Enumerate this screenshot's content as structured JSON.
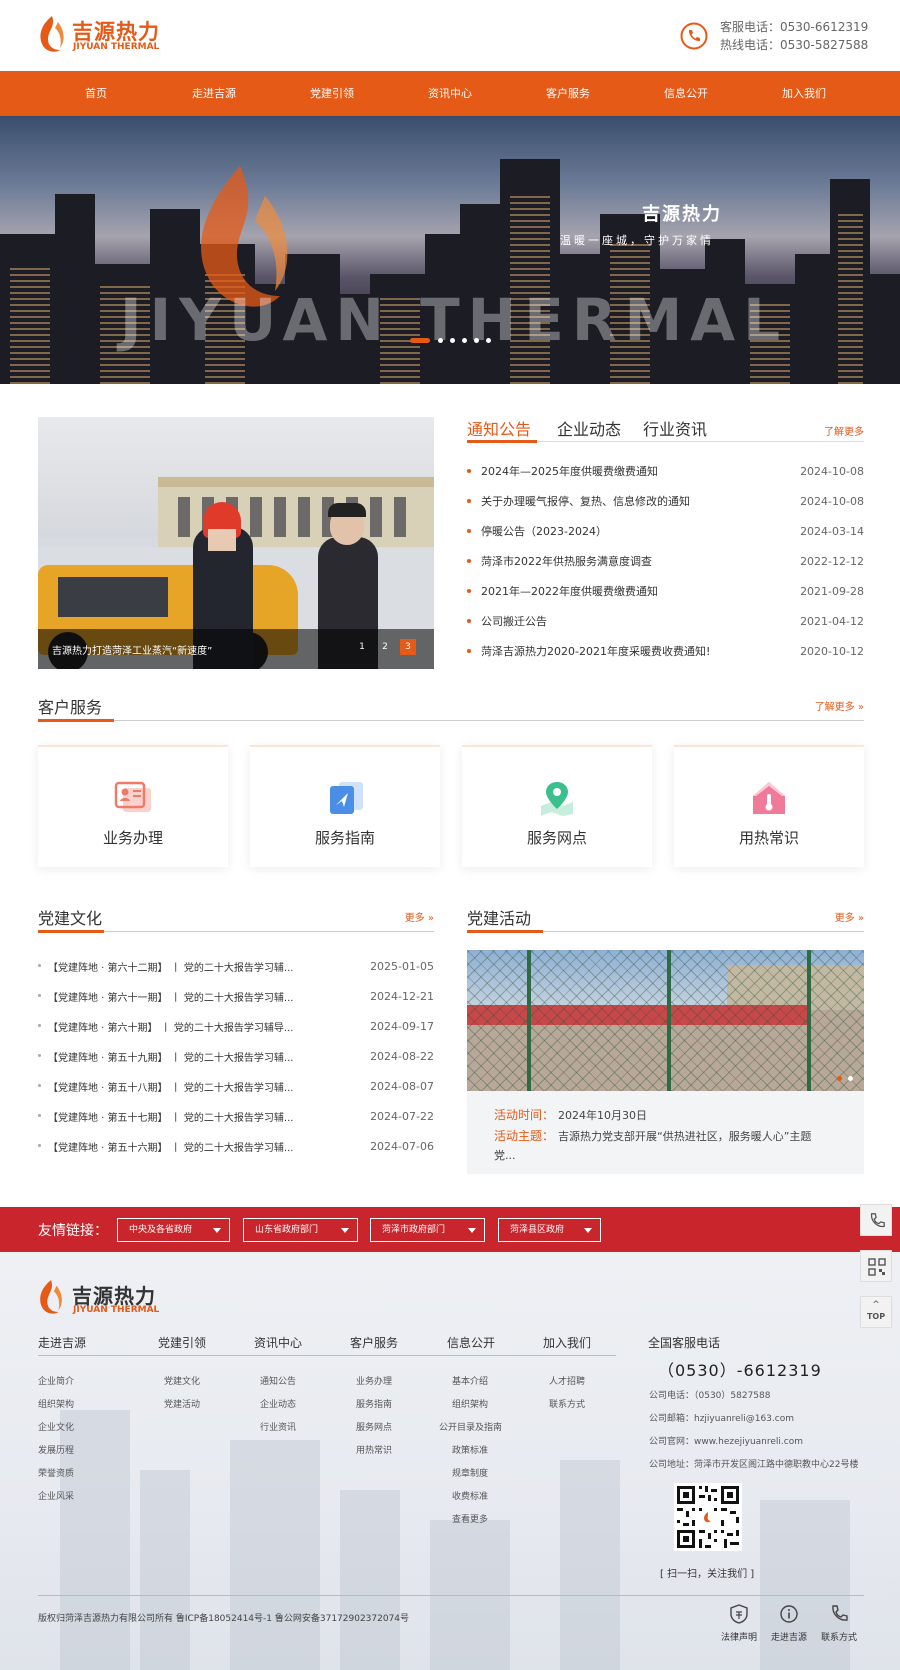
{
  "header": {
    "logo_cn": "吉源热力",
    "logo_en": "JIYUAN THERMAL",
    "hotline1": "客服电话：0530-6612319",
    "hotline2": "热线电话：0530-5827588"
  },
  "nav": [
    "首页",
    "走进吉源",
    "党建引领",
    "资讯中心",
    "客户服务",
    "信息公开",
    "加入我们"
  ],
  "banner": {
    "title": "吉源热力",
    "slogan": "温暖一座城，守护万家情",
    "watermark": "JIYUAN THERMAL"
  },
  "news": {
    "caption": "吉源热力打造菏泽工业蒸汽“新速度”",
    "pages": [
      "1",
      "2",
      "3"
    ],
    "tabs": [
      "通知公告",
      "企业动态",
      "行业资讯"
    ],
    "more": "了解更多",
    "items": [
      {
        "title": "2024年—2025年度供暖费缴费通知",
        "date": "2024-10-08"
      },
      {
        "title": "关于办理暖气报停、复热、信息修改的通知",
        "date": "2024-10-08"
      },
      {
        "title": "停暖公告（2023-2024）",
        "date": "2024-03-14"
      },
      {
        "title": "菏泽市2022年供热服务满意度调查",
        "date": "2022-12-12"
      },
      {
        "title": "2021年—2022年度供暖费缴费通知",
        "date": "2021-09-28"
      },
      {
        "title": "公司搬迁公告",
        "date": "2021-04-12"
      },
      {
        "title": "菏泽吉源热力2020-2021年度采暖费收费通知!",
        "date": "2020-10-12"
      }
    ]
  },
  "service": {
    "title": "客户服务",
    "more": "了解更多",
    "cards": [
      {
        "label": "业务办理",
        "icon": "id-card-icon",
        "color": "#f07a6a"
      },
      {
        "label": "服务指南",
        "icon": "guide-book-icon",
        "color": "#4a8ee6"
      },
      {
        "label": "服务网点",
        "icon": "map-pin-icon",
        "color": "#3bbf8c"
      },
      {
        "label": "用热常识",
        "icon": "house-thermometer-icon",
        "color": "#f07a9a"
      }
    ]
  },
  "party_culture": {
    "title": "党建文化",
    "more": "更多",
    "items": [
      {
        "title": "【党建阵地 · 第六十二期】 丨 党的二十大报告学习辅...",
        "date": "2025-01-05"
      },
      {
        "title": "【党建阵地 · 第六十一期】 丨 党的二十大报告学习辅...",
        "date": "2024-12-21"
      },
      {
        "title": "【党建阵地 · 第六十期】 丨 党的二十大报告学习辅导...",
        "date": "2024-09-17"
      },
      {
        "title": "【党建阵地 · 第五十九期】 丨 党的二十大报告学习辅...",
        "date": "2024-08-22"
      },
      {
        "title": "【党建阵地 · 第五十八期】 丨 党的二十大报告学习辅...",
        "date": "2024-08-07"
      },
      {
        "title": "【党建阵地 · 第五十七期】 丨 党的二十大报告学习辅...",
        "date": "2024-07-22"
      },
      {
        "title": "【党建阵地 · 第五十六期】 丨 党的二十大报告学习辅...",
        "date": "2024-07-06"
      }
    ]
  },
  "party_activity": {
    "title": "党建活动",
    "more": "更多",
    "time_label": "活动时间：",
    "time_value": "2024年10月30日",
    "theme_label": "活动主题：",
    "theme_value": "吉源热力党支部开展“供热进社区，服务暖人心”主题",
    "theme_value2": "党..."
  },
  "links": {
    "title": "友情链接：",
    "selects": [
      "中央及各省政府",
      "山东省政府部门",
      "菏泽市政府部门",
      "菏泽县区政府"
    ]
  },
  "side": {
    "top_label": "TOP"
  },
  "footer": {
    "logo_cn": "吉源热力",
    "logo_en": "JIYUAN THERMAL",
    "columns": [
      {
        "head": "走进吉源",
        "links": [
          "企业简介",
          "组织架构",
          "企业文化",
          "发展历程",
          "荣誉资质",
          "企业风采"
        ]
      },
      {
        "head": "党建引领",
        "links": [
          "党建文化",
          "党建活动"
        ]
      },
      {
        "head": "资讯中心",
        "links": [
          "通知公告",
          "企业动态",
          "行业资讯"
        ]
      },
      {
        "head": "客户服务",
        "links": [
          "业务办理",
          "服务指南",
          "服务网点",
          "用热常识"
        ]
      },
      {
        "head": "信息公开",
        "links": [
          "基本介绍",
          "组织架构",
          "公开目录及指南",
          "政策标准",
          "规章制度",
          "收费标准",
          "查看更多"
        ]
      },
      {
        "head": "加入我们",
        "links": [
          "人才招聘",
          "联系方式"
        ]
      }
    ],
    "service_title": "全国客服电话",
    "service_phone": "（0530）-6612319",
    "contacts": [
      "公司电话：（0530）5827588",
      "公司邮箱：hzjiyuanreli@163.com",
      "公司官网：www.hezejiyuanreli.com",
      "公司地址：菏泽市开发区阁江路中德职教中心22号楼"
    ],
    "qr_caption": "[ 扫一扫，关注我们 ]",
    "copyright": "版权归菏泽吉源热力有限公司所有     鲁ICP备18052414号-1     鲁公网安备37172902372074号",
    "bottom_icons": [
      "法律声明",
      "走进吉源",
      "联系方式"
    ]
  }
}
